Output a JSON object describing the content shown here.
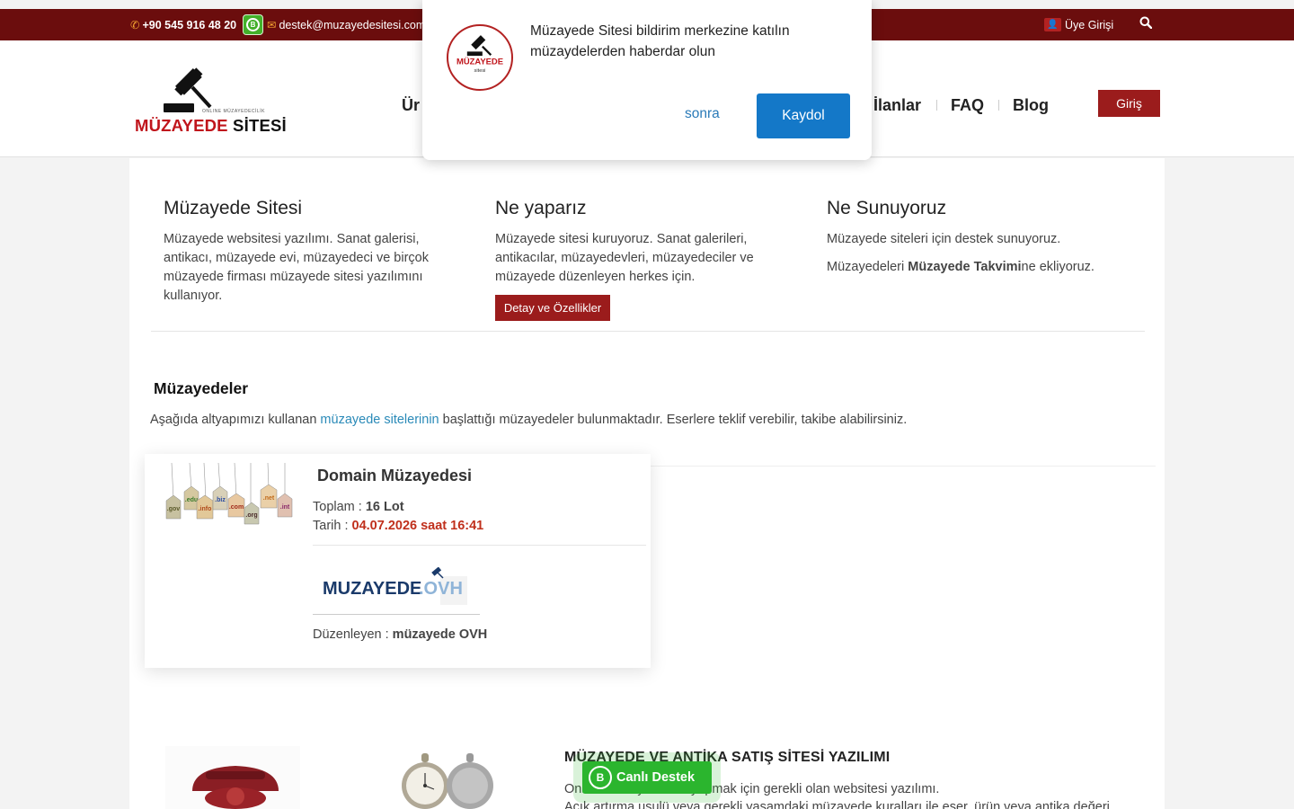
{
  "topbar": {
    "phone": "+90 545 916 48 20",
    "email": "destek@muzayedesitesi.com",
    "login_label": "Üye Girişi"
  },
  "header": {
    "logo_tagline": "ONLINE MÜZAYEDECİLİK",
    "logo_name_red": "MÜZAYEDE",
    "logo_name_dark": " SİTESİ",
    "nav": [
      "Ür",
      "İlanlar",
      "FAQ",
      "Blog"
    ],
    "login_button": "Giriş"
  },
  "intro": {
    "col1_title": "Müzayede Sitesi",
    "col1_text": "Müzayede websitesi yazılımı. Sanat galerisi, antikacı, müzayede evi, müzayedeci ve birçok müzayede firması müzayede sitesi yazılımını kullanıyor.",
    "col2_title": "Ne yaparız",
    "col2_text": "Müzayede sitesi kuruyoruz. Sanat galerileri, antikacılar, müzayedevleri, müzayedeciler ve müzayede düzenleyen herkes için.",
    "col2_button": "Detay ve Özellikler",
    "col3_title": "Ne Sunuyoruz",
    "col3_text1": "Müzayede siteleri için destek sunuyoruz.",
    "col3_text2_pre": "Müzayedeleri ",
    "col3_text2_bold": "Müzayede Takvimi",
    "col3_text2_post": "ne ekliyoruz."
  },
  "auctions": {
    "title": "Müzayedeler",
    "desc_pre": "Aşağıda altyapımızı kullanan ",
    "desc_link": "müzayede sitelerinin",
    "desc_post": " başlattığı müzayedeler bulunmaktadır. Eserlere teklif verebilir, takibe alabilirsiniz.",
    "card": {
      "title": "Domain Müzayedesi",
      "total_label": "Toplam : ",
      "total_value": "16 Lot",
      "date_label": "Tarih : ",
      "date_value": "04.07.2026 saat 16:41",
      "organizer_label": "Düzenleyen : ",
      "organizer_value": "müzayede OVH",
      "organizer_logo_text_dark": "MUZAYEDE",
      "organizer_logo_text_light": ".OVH",
      "domain_tags": [
        ".gov",
        ".edu",
        ".info",
        ".biz",
        ".com",
        ".org",
        ".net",
        ".int"
      ]
    }
  },
  "software": {
    "title": "MÜZAYEDE VE ANTİKA SATIŞ SİTESİ YAZILIMI",
    "p1": "Online müzayedecilik yapmak için gerekli olan websitesi yazılımı.",
    "p2": "Açık artırma usulü veya gerekli yasamdaki müzayede kuralları ile eser, ürün veya antika değeri"
  },
  "live_support": "Canlı Destek",
  "popup": {
    "logo_text": "MÜZAYEDE",
    "logo_sub": "sitesi",
    "message": "Müzayede Sitesi bildirim merkezine katılın müzaydelerden haberdar olun",
    "later": "sonra",
    "subscribe": "Kaydol"
  },
  "colors": {
    "topbar": "#6b0d0d",
    "brand_red": "#9b1c1c",
    "link_blue": "#2a8ab8",
    "subscribe_blue": "#1478c8",
    "whatsapp_green": "#2bb52e"
  }
}
